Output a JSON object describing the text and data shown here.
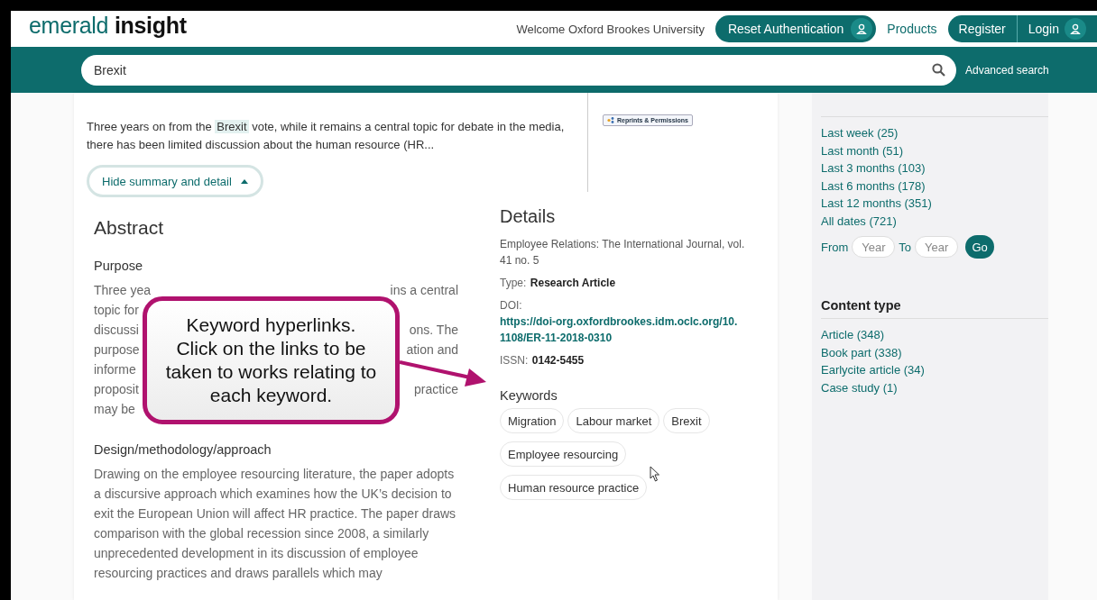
{
  "header": {
    "logo_light": "emerald",
    "logo_bold": "insight",
    "welcome": "Welcome Oxford Brookes University",
    "reset_button": "Reset Authentication",
    "products": "Products",
    "register": "Register",
    "login": "Login"
  },
  "search": {
    "value": "Brexit",
    "advanced": "Advanced search"
  },
  "summary": {
    "before": "Three years on from the ",
    "highlight": "Brexit",
    "after": " vote, while it remains a central topic for debate in the media, there has been limited discussion about the human resource (HR...",
    "toggle": "Hide summary and detail",
    "expanded": true,
    "reprints": "Reprints & Permissions"
  },
  "abstract": {
    "title": "Abstract",
    "purpose_heading": "Purpose",
    "purpose_lines": [
      {
        "left": "Three yea",
        "right": "ins a central"
      },
      {
        "left": "topic for"
      },
      {
        "left": "discussi",
        "right": "ons. The"
      },
      {
        "left": "purpose",
        "right": "ation and"
      },
      {
        "left": "informe"
      },
      {
        "left": "proposit",
        "right": "practice"
      },
      {
        "left": "may be"
      }
    ],
    "design_heading": "Design/methodology/approach",
    "design_text": "Drawing on the employee resourcing literature, the paper adopts a discursive approach which examines how the UK’s decision to exit the European Union will affect HR practice. The paper draws comparison with the global recession since 2008, a similarly unprecedented development in its discussion of employee resourcing practices and draws parallels which may"
  },
  "callout": {
    "text": "Keyword hyperlinks. Click on the links to be taken to works relating to each keyword."
  },
  "details": {
    "title": "Details",
    "journal": "Employee Relations: The International Journal, vol. 41 no. 5",
    "type_label": "Type:",
    "type_value": "Research Article",
    "doi_label": "DOI:",
    "doi_value": "https://doi-org.oxfordbrookes.idm.oclc.org/10.1108/ER-11-2018-0310",
    "issn_label": "ISSN:",
    "issn_value": "0142-5455",
    "keywords_title": "Keywords",
    "keywords": [
      "Migration",
      "Labour market",
      "Brexit",
      "Employee resourcing",
      "Human resource practice"
    ]
  },
  "sidebar": {
    "year_filters": [
      "Last week (25)",
      "Last month (51)",
      "Last 3 months (103)",
      "Last 6 months (178)",
      "Last 12 months (351)",
      "All dates (721)"
    ],
    "from": "From",
    "to": "To",
    "year_placeholder_from": "Year",
    "year_placeholder_to": "Year",
    "go": "Go",
    "content_type_title": "Content type",
    "content_types": [
      "Article (348)",
      "Book part (338)",
      "Earlycite article (34)",
      "Case study (1)"
    ]
  }
}
